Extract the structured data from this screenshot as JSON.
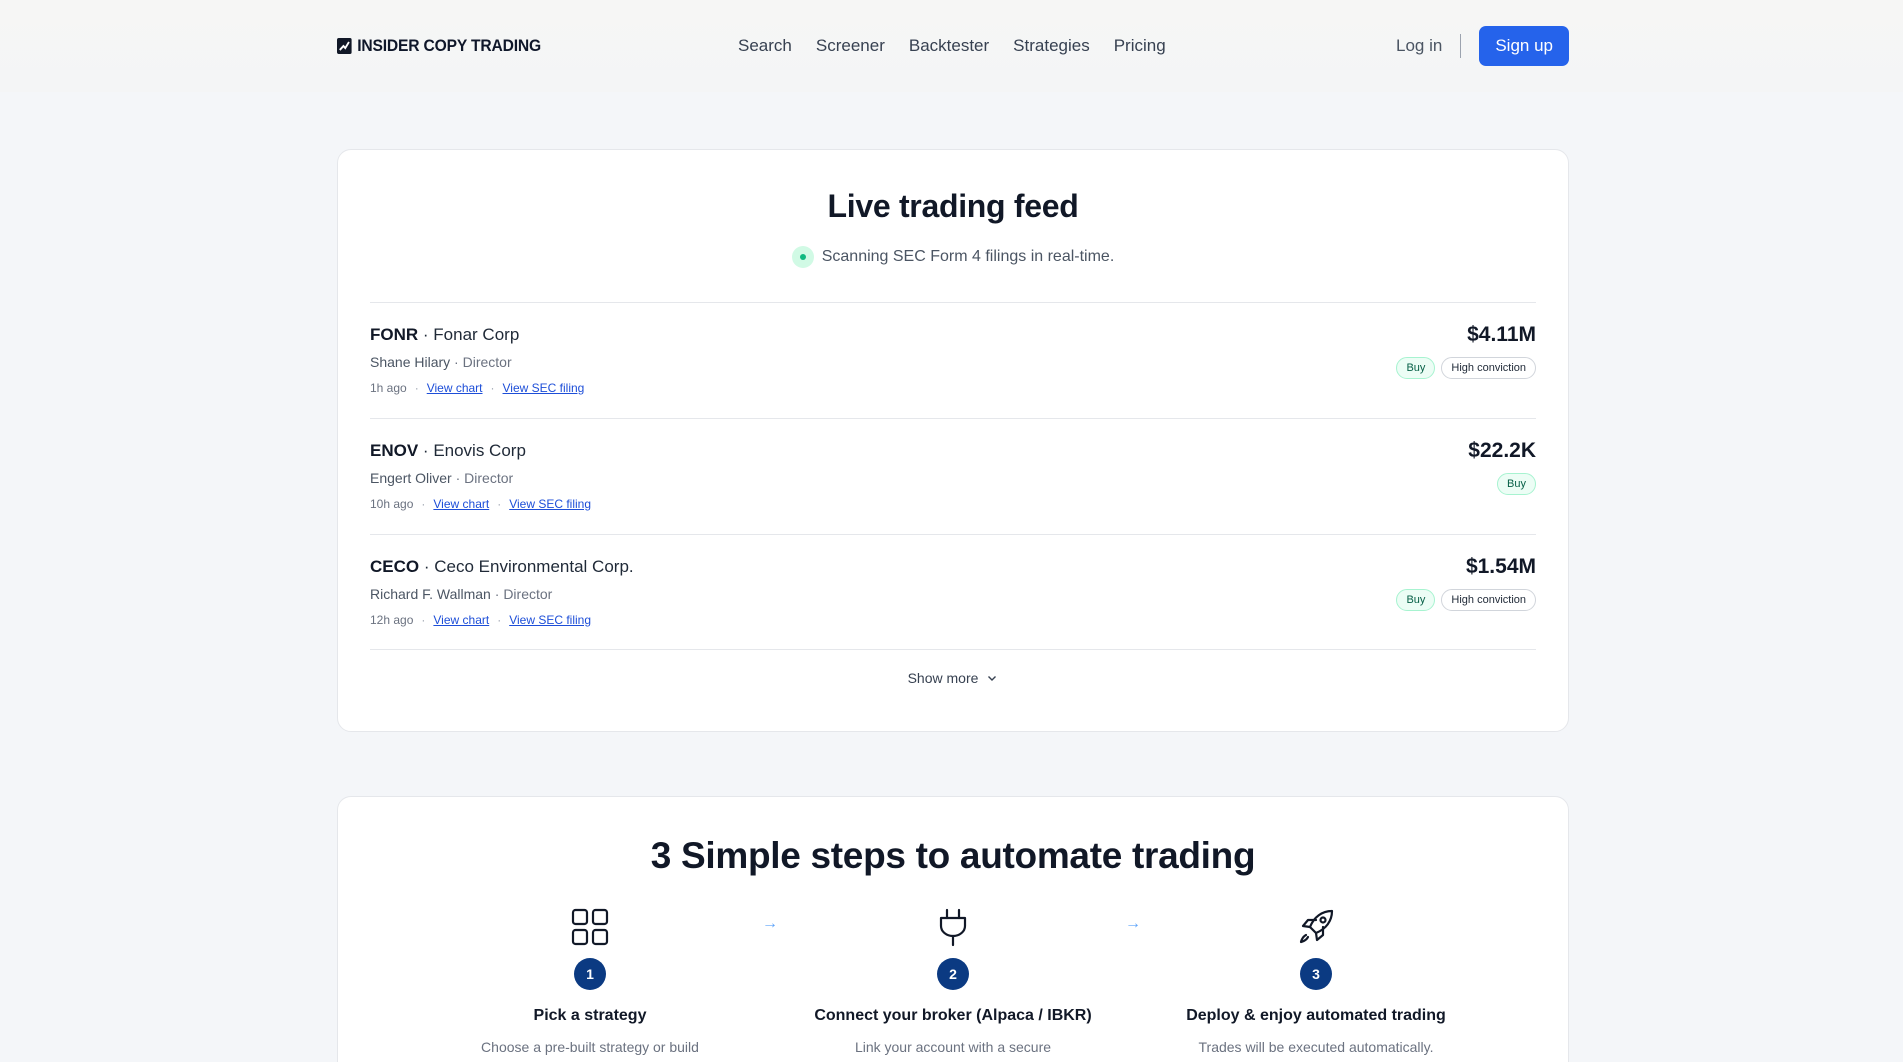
{
  "header": {
    "logo_text": "INSIDER COPY TRADING",
    "nav": [
      "Search",
      "Screener",
      "Backtester",
      "Strategies",
      "Pricing"
    ],
    "login": "Log in",
    "signup": "Sign up"
  },
  "feed": {
    "title": "Live trading feed",
    "subtitle": "Scanning SEC Form 4 filings in real-time.",
    "rows": [
      {
        "ticker": "FONR",
        "company": "Fonar Corp",
        "insider": "Shane Hilary",
        "role": "Director",
        "time": "1h ago",
        "chart_link": "View chart",
        "filing_link": "View SEC filing",
        "amount": "$4.11M",
        "badges": [
          "Buy",
          "High conviction"
        ]
      },
      {
        "ticker": "ENOV",
        "company": "Enovis Corp",
        "insider": "Engert Oliver",
        "role": "Director",
        "time": "10h ago",
        "chart_link": "View chart",
        "filing_link": "View SEC filing",
        "amount": "$22.2K",
        "badges": [
          "Buy"
        ]
      },
      {
        "ticker": "CECO",
        "company": "Ceco Environmental Corp.",
        "insider": "Richard F. Wallman",
        "role": "Director",
        "time": "12h ago",
        "chart_link": "View chart",
        "filing_link": "View SEC filing",
        "amount": "$1.54M",
        "badges": [
          "Buy",
          "High conviction"
        ]
      }
    ],
    "show_more": "Show more"
  },
  "steps": {
    "title": "3 Simple steps to automate trading",
    "items": [
      {
        "number": "1",
        "icon": "grid-icon",
        "title": "Pick a strategy",
        "desc": "Choose a pre-built strategy or build your own."
      },
      {
        "number": "2",
        "icon": "plug-icon",
        "title": "Connect your broker (Alpaca / IBKR)",
        "desc": "Link your account with a secure connection."
      },
      {
        "number": "3",
        "icon": "rocket-icon",
        "title": "Deploy & enjoy automated trading",
        "desc": "Trades will be executed automatically."
      }
    ],
    "arrow": "→"
  },
  "colors": {
    "accent": "#2563eb",
    "step_badge": "#0b3a82",
    "live": "#10b981",
    "buy_bg": "#ecfdf5"
  }
}
